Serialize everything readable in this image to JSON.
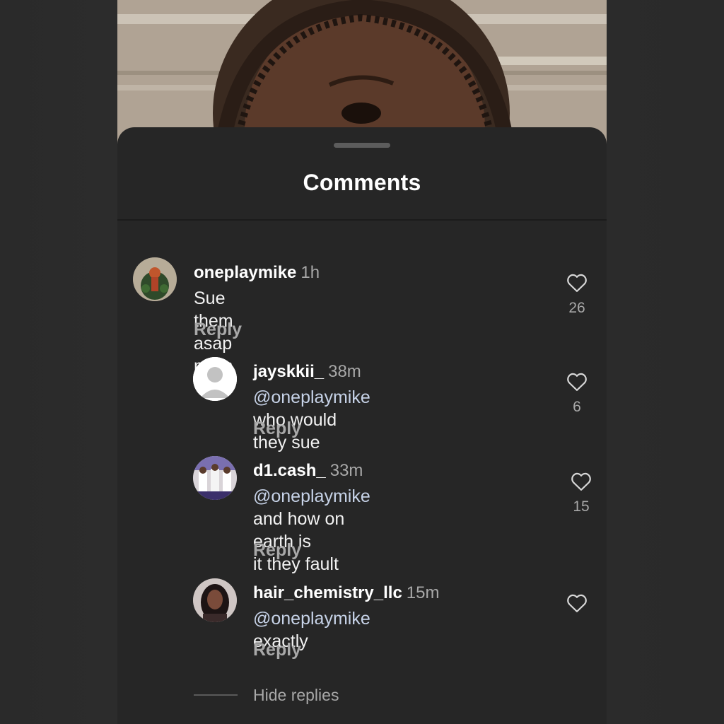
{
  "sheet": {
    "title": "Comments"
  },
  "comments": [
    {
      "username": "oneplaymike",
      "time": "1h",
      "text": "Sue them asap mom",
      "reply_label": "Reply",
      "likes": "26"
    },
    {
      "username": "jayskkii_",
      "time": "38m",
      "mention": "@oneplaymike",
      "text": " who would they sue",
      "reply_label": "Reply",
      "likes": "6"
    },
    {
      "username": "d1.cash_",
      "time": "33m",
      "mention": "@oneplaymike",
      "text": " and how on earth is",
      "text_line2": "it they fault",
      "reply_label": "Reply",
      "likes": "15"
    },
    {
      "username": "hair_chemistry_llc",
      "time": "15m",
      "mention": "@oneplaymike",
      "text": " exactly",
      "reply_label": "Reply"
    }
  ],
  "hide_replies_label": "Hide replies",
  "colors": {
    "background": "#262626",
    "username": "#ffffff",
    "muted": "#a8a8a8",
    "mention": "#c7d3e8"
  },
  "icons": {
    "like": "heart-outline-icon",
    "avatar_default": "default-avatar-icon"
  }
}
